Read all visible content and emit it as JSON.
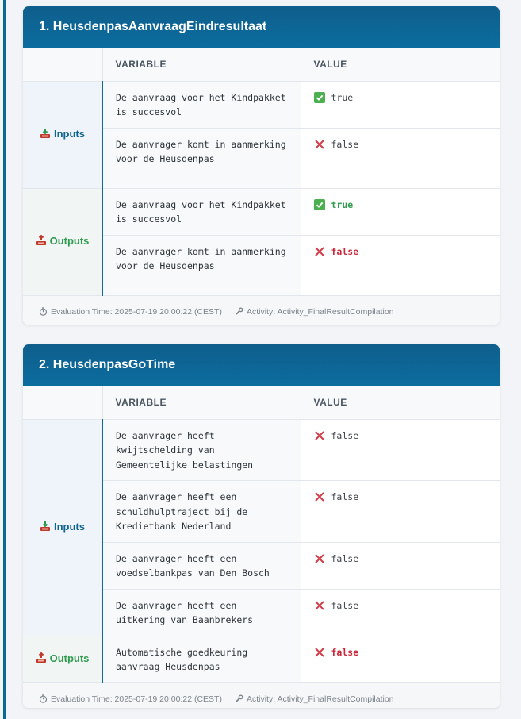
{
  "colors": {
    "header_bg": "#0b6d9e",
    "inputs_label": "#0f6592",
    "outputs_label": "#2e9a4e",
    "true_value": "#2e9a4e",
    "false_value": "#c8283a"
  },
  "table_headers": {
    "variable": "VARIABLE",
    "value": "VALUE"
  },
  "cards": [
    {
      "title": "1. HeusdenpasAanvraagEindresultaat",
      "inputs_label": "Inputs",
      "outputs_label": "Outputs",
      "inputs": [
        {
          "variable": "De aanvraag voor het Kindpakket is succesvol",
          "value": "true",
          "icon": "check-icon"
        },
        {
          "variable": "De aanvrager komt in aanmerking voor de Heusdenpas",
          "value": "false",
          "icon": "x-icon"
        }
      ],
      "outputs": [
        {
          "variable": "De aanvraag voor het Kindpakket is succesvol",
          "value": "true",
          "icon": "check-icon"
        },
        {
          "variable": "De aanvrager komt in aanmerking voor de Heusdenpas",
          "value": "false",
          "icon": "x-icon"
        }
      ],
      "footer": {
        "evaluation_time": "Evaluation Time: 2025-07-19 20:00:22 (CEST)",
        "activity": "Activity: Activity_FinalResultCompilation"
      }
    },
    {
      "title": "2. HeusdenpasGoTime",
      "inputs_label": "Inputs",
      "outputs_label": "Outputs",
      "inputs": [
        {
          "variable": "De aanvrager heeft kwijtschelding van Gemeentelijke belastingen",
          "value": "false",
          "icon": "x-icon"
        },
        {
          "variable": "De aanvrager heeft een schuldhulptraject bij de Kredietbank Nederland",
          "value": "false",
          "icon": "x-icon"
        },
        {
          "variable": "De aanvrager heeft een voedselbankpas van Den Bosch",
          "value": "false",
          "icon": "x-icon"
        },
        {
          "variable": "De aanvrager heeft een uitkering van Baanbrekers",
          "value": "false",
          "icon": "x-icon"
        }
      ],
      "outputs": [
        {
          "variable": "Automatische goedkeuring aanvraag Heusdenpas",
          "value": "false",
          "icon": "x-icon"
        }
      ],
      "footer": {
        "evaluation_time": "Evaluation Time: 2025-07-19 20:00:22 (CEST)",
        "activity": "Activity: Activity_FinalResultCompilation"
      }
    }
  ]
}
